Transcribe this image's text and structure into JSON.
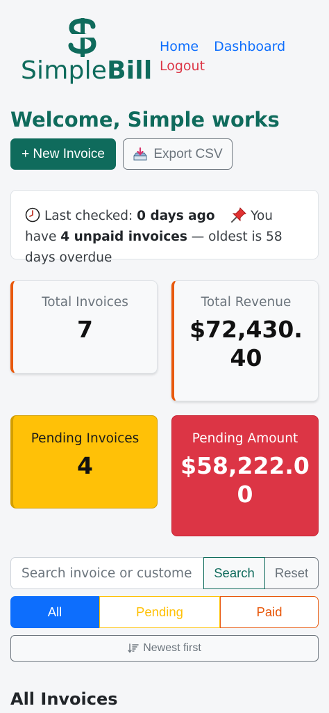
{
  "brand": {
    "name_light": "Simple",
    "name_bold": "Bill",
    "color": "#0f6b5c"
  },
  "nav": {
    "home": "Home",
    "dashboard": "Dashboard",
    "logout": "Logout"
  },
  "welcome": "Welcome, Simple works",
  "actions": {
    "new_invoice": "+ New Invoice",
    "export_csv": "Export CSV"
  },
  "status": {
    "last_checked_label": "Last checked:",
    "last_checked_value": "0 days ago",
    "unpaid_prefix": "You have",
    "unpaid_bold": "4 unpaid invoices",
    "unpaid_suffix": "— oldest is 58 days overdue",
    "clock_icon": "clock-icon",
    "pin_icon": "pushpin-icon"
  },
  "stats": {
    "total_invoices": {
      "label": "Total Invoices",
      "value": "7"
    },
    "total_revenue": {
      "label": "Total Revenue",
      "value": "$72,430.40"
    },
    "pending_invoices": {
      "label": "Pending Invoices",
      "value": "4"
    },
    "pending_amount": {
      "label": "Pending Amount",
      "value": "$58,222.00"
    }
  },
  "search": {
    "placeholder": "Search invoice or customer",
    "value": "",
    "search_label": "Search",
    "reset_label": "Reset"
  },
  "filters": {
    "all": "All",
    "pending": "Pending",
    "paid": "Paid",
    "active": "All"
  },
  "sort": {
    "label": "Newest first"
  },
  "section": {
    "title": "All Invoices"
  },
  "colors": {
    "primary": "#0f6b5c",
    "link": "#0d6efd",
    "danger": "#dc3545",
    "warning": "#ffc107",
    "orange": "#e8590c"
  }
}
